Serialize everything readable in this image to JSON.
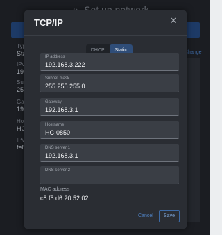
{
  "background": {
    "title": "Set up network",
    "fields": [
      {
        "label": "Type",
        "value": "Static"
      },
      {
        "label": "IPv4 add",
        "value": "192.16"
      },
      {
        "label": "Subnet m",
        "value": "255.25"
      },
      {
        "label": "Gateway",
        "value": "192.16"
      },
      {
        "label": "Hostnam",
        "value": "HC-085"
      },
      {
        "label": "IPv6 add",
        "value": "fe80::3"
      }
    ],
    "link": "Change"
  },
  "dialog": {
    "title": "TCP/IP",
    "close_glyph": "✕",
    "mode_options": [
      "DHCP",
      "Static"
    ],
    "selected_mode": "Static",
    "fields": [
      {
        "label": "IP address",
        "value": "192.168.3.222"
      },
      {
        "label": "Subnet mask",
        "value": "255.255.255.0"
      },
      {
        "label": "Gateway",
        "value": "192.168.3.1"
      },
      {
        "label": "Hostname",
        "value": "HC-0850"
      },
      {
        "label": "DNS server 1",
        "value": "192.168.3.1"
      },
      {
        "label": "DNS server 2",
        "value": ""
      }
    ],
    "mac_label": "MAC address",
    "mac_value": "c8:f5:d6:20:52:02",
    "cancel_label": "Cancel",
    "save_label": "Save"
  },
  "colors": {
    "accent": "#2f4d78",
    "link": "#4f82c4",
    "dialog_bg": "#2a2d33",
    "field_bg": "#3a3e45"
  }
}
